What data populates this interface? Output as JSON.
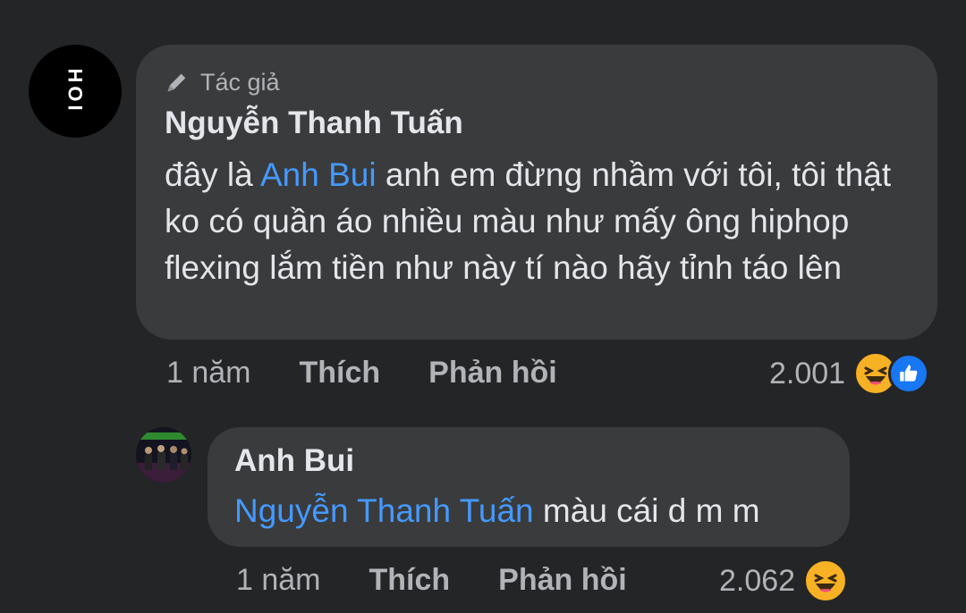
{
  "comment": {
    "avatar_text": "HOI",
    "author_badge": "Tác giả",
    "author_name": "Nguyễn Thanh Tuấn",
    "text_before": "đây là ",
    "mention": "Anh Bui",
    "text_after": " anh em đừng nhầm với tôi, tôi thật ko có quần áo nhiều màu như mấy ông hiphop flexing lắm tiền như này tí nào hãy tỉnh táo lên",
    "time": "1 năm",
    "like_label": "Thích",
    "reply_label": "Phản hồi",
    "reaction_count": "2.001",
    "reactions": [
      "haha-emoji",
      "like-emoji"
    ]
  },
  "reply": {
    "author_name": "Anh Bui",
    "mention": "Nguyễn Thanh Tuấn",
    "text_after": " màu cái d m m",
    "time": "1 năm",
    "like_label": "Thích",
    "reply_label": "Phản hồi",
    "reaction_count": "2.062",
    "reactions": [
      "haha-emoji"
    ]
  },
  "colors": {
    "background": "#242526",
    "bubble": "#3a3b3c",
    "mention": "#4599ff",
    "secondary_text": "#b0b3b8",
    "like_blue": "#1877f2",
    "haha_yellow": "#f7b125"
  }
}
